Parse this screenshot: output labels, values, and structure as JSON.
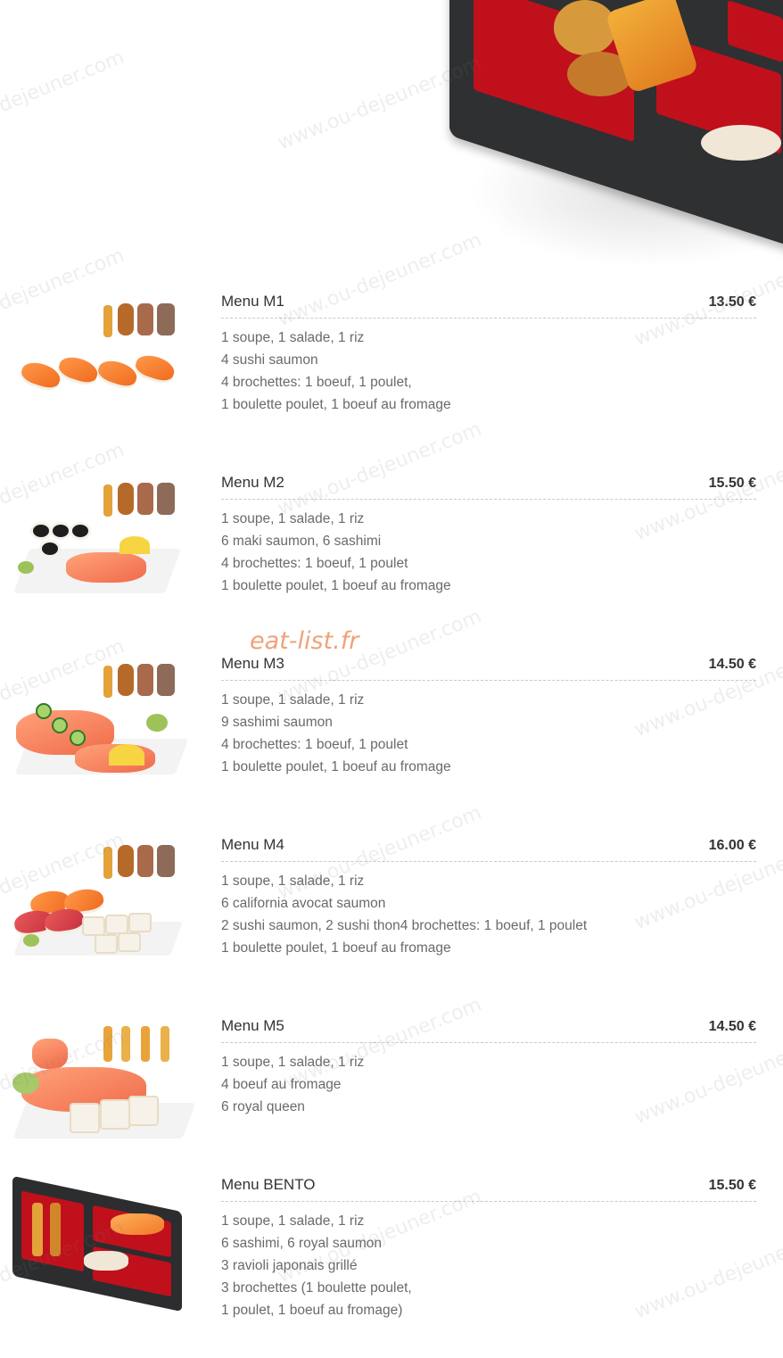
{
  "watermark": {
    "text_long": "www.ou-dejeuner.com",
    "text_short": "dejeuner.com"
  },
  "overlay_logo": "eat-list.fr",
  "menus": [
    {
      "title": "Menu M1",
      "price": "13.50 €",
      "lines": [
        "1 soupe, 1 salade, 1 riz",
        "4 sushi saumon",
        "4 brochettes: 1 boeuf, 1 poulet,",
        "1 boulette poulet, 1 boeuf au fromage"
      ]
    },
    {
      "title": "Menu M2",
      "price": "15.50 €",
      "lines": [
        "1 soupe, 1 salade, 1 riz",
        "6 maki saumon, 6 sashimi",
        "4 brochettes: 1 boeuf, 1 poulet",
        "1 boulette poulet, 1 boeuf au fromage"
      ]
    },
    {
      "title": "Menu M3",
      "price": "14.50 €",
      "lines": [
        "1 soupe, 1 salade, 1 riz",
        "9 sashimi saumon",
        "4 brochettes: 1 boeuf, 1 poulet",
        "1 boulette poulet, 1 boeuf au fromage"
      ]
    },
    {
      "title": "Menu M4",
      "price": "16.00 €",
      "lines": [
        "1 soupe, 1 salade, 1 riz",
        "6 california avocat saumon",
        "2 sushi saumon, 2 sushi thon4 brochettes: 1 boeuf, 1 poulet",
        "1 boulette poulet, 1 boeuf au fromage"
      ]
    },
    {
      "title": "Menu M5",
      "price": "14.50 €",
      "lines": [
        "1 soupe, 1 salade, 1 riz",
        "4 boeuf au fromage",
        "6 royal queen"
      ]
    },
    {
      "title": "Menu BENTO",
      "price": "15.50 €",
      "lines": [
        "1 soupe, 1 salade, 1 riz",
        "6 sashimi, 6 royal saumon",
        "3 ravioli japonais grillé",
        "3 brochettes (1 boulette poulet,",
        "1 poulet, 1 boeuf au fromage)"
      ]
    }
  ]
}
